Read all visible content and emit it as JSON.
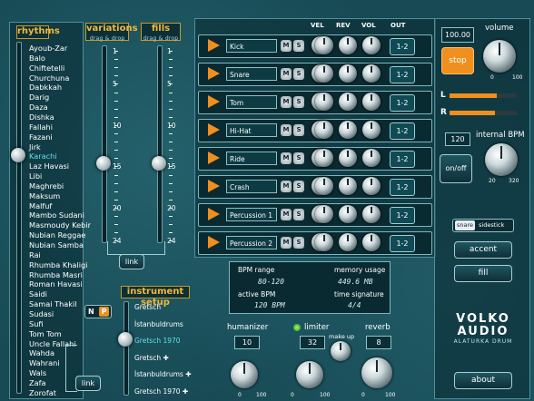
{
  "rhythms": {
    "header": "rhythms",
    "items": [
      "Ayoub-Zar",
      "Balo",
      "Chiftetelli",
      "Churchuna",
      "Dabkkah",
      "Darig",
      "Daza",
      "Dishka",
      "Fallahi",
      "Fazani",
      "Jirk",
      "Karachi",
      "Laz Havasi",
      "Libi",
      "Maghrebi",
      "Maksum",
      "Malfuf",
      "Mambo Sudani",
      "Masmoudy Kebir",
      "Nubian Reggae",
      "Nubian Samba",
      "Rai",
      "Rhumba Khaligi",
      "Rhumba Masri",
      "Roman Havasi",
      "Saidi",
      "Samai Thakil",
      "Sudasi",
      "Sufi",
      "Tom Tom",
      "Uncle Fallahi",
      "Wahda",
      "Wahrani",
      "Wals",
      "Zafa",
      "Zorofat"
    ],
    "selected": "Karachi"
  },
  "variations": {
    "title": "variations",
    "subtitle": "drag & drop",
    "ticks": [
      "1",
      "",
      "",
      "",
      "5",
      "",
      "",
      "",
      "",
      "10",
      "",
      "",
      "",
      "",
      "15",
      "",
      "",
      "",
      "",
      "20",
      "",
      "",
      "",
      "24"
    ],
    "value": 15
  },
  "fills": {
    "title": "fills",
    "subtitle": "drag & drop",
    "ticks": [
      "1",
      "",
      "",
      "",
      "5",
      "",
      "",
      "",
      "",
      "10",
      "",
      "",
      "",
      "",
      "15",
      "",
      "",
      "",
      "",
      "20",
      "",
      "",
      "",
      "24"
    ],
    "value": 15
  },
  "link_label": "link",
  "instrument_setup": {
    "header": "instrument setup",
    "np": [
      "N",
      "P"
    ],
    "items": [
      "Gretsch",
      "İstanbuldrums",
      "Gretsch 1970",
      "Gretsch ✚",
      "İstanbuldrums ✚",
      "Gretsch 1970 ✚"
    ],
    "selected": "Gretsch 1970"
  },
  "mixer": {
    "columns": {
      "vel": "VEL",
      "rev": "REV",
      "vol": "VOL",
      "out": "OUT"
    },
    "tracks": [
      {
        "name": "Kick",
        "out": "1-2"
      },
      {
        "name": "Snare",
        "out": "1-2"
      },
      {
        "name": "Tom",
        "out": "1-2"
      },
      {
        "name": "Hi-Hat",
        "out": "1-2"
      },
      {
        "name": "Ride",
        "out": "1-2"
      },
      {
        "name": "Crash",
        "out": "1-2"
      },
      {
        "name": "Percussion 1",
        "out": "1-2"
      },
      {
        "name": "Percussion 2",
        "out": "1-2"
      }
    ],
    "m": "M",
    "s": "S"
  },
  "info": {
    "bpm_range_label": "BPM range",
    "bpm_range": "80-120",
    "memory_label": "memory usage",
    "memory": "449.6 MB",
    "active_bpm_label": "active BPM",
    "active_bpm": "120 BPM",
    "time_sig_label": "time signature",
    "time_sig": "4/4"
  },
  "bottom": {
    "humanizer_label": "humanizer",
    "humanizer": "10",
    "limiter_label": "limiter",
    "limiter": "32",
    "makeup_label": "make up",
    "reverb_label": "reverb",
    "reverb": "8",
    "knob_min": "0",
    "knob_max": "100"
  },
  "right": {
    "volume_value": "100.00",
    "volume_label": "volume",
    "stop_label": "stop",
    "vol_min": "0",
    "vol_max": "100",
    "l_label": "L",
    "r_label": "R",
    "bpm_value": "120",
    "bpm_label": "internal BPM",
    "onoff_label": "on/off",
    "bpm_min": "20",
    "bpm_max": "320",
    "snare_label": "snare",
    "sidestick_label": "sidestick",
    "accent_label": "accent",
    "fill_label": "fill",
    "brand_line1": "VOLKO",
    "brand_line2": "AUDIO",
    "brand_line3": "ALATURKA DRUM",
    "about_label": "about"
  },
  "colors": {
    "accent": "#f08f1e",
    "highlight": "#5fe0ea",
    "panel_border": "#4f8f98"
  }
}
